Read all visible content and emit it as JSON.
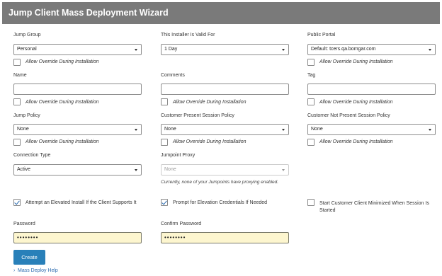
{
  "title": "Jump Client Mass Deployment Wizard",
  "labels": {
    "jump_group": "Jump Group",
    "valid_for": "This Installer Is Valid For",
    "public_portal": "Public Portal",
    "name": "Name",
    "comments": "Comments",
    "tag": "Tag",
    "jump_policy": "Jump Policy",
    "customer_present": "Customer Present Session Policy",
    "customer_not_present": "Customer Not Present Session Policy",
    "connection_type": "Connection Type",
    "jumpoint_proxy": "Jumpoint Proxy",
    "password": "Password",
    "confirm_password": "Confirm Password"
  },
  "values": {
    "jump_group": "Personal",
    "valid_for": "1 Day",
    "public_portal": "Default: tcers.qa.bomgar.com",
    "name": "",
    "comments": "",
    "tag": "",
    "jump_policy": "None",
    "customer_present": "None",
    "customer_not_present": "None",
    "connection_type": "Active",
    "jumpoint_proxy": "None",
    "password": "••••••••",
    "confirm_password": "••••••••"
  },
  "override_label": "Allow Override During Installation",
  "proxy_note": "Currently, none of your Jumpoints have proxying enabled.",
  "options": {
    "elevated_install": "Attempt an Elevated Install If the Client Supports It",
    "prompt_elevation": "Prompt for Elevation Credentials If Needed",
    "start_minimized": "Start Customer Client Minimized When Session Is Started"
  },
  "checked": {
    "elevated_install": true,
    "prompt_elevation": true,
    "start_minimized": false
  },
  "create_label": "Create",
  "help_link": "Mass Deploy Help",
  "accent_color": "#2980b9",
  "header_color": "#7a7a7a",
  "password_bg": "#fdf6cf"
}
